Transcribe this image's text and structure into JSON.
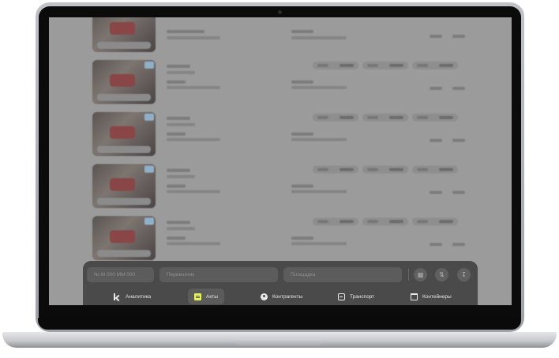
{
  "search": {
    "number_placeholder": "№ М 000 ММ 000",
    "carrier_placeholder": "Перевозчик",
    "area_placeholder": "Площадка"
  },
  "toolbar": {
    "calendar_icon": "calendar-icon",
    "sort_icon": "sort-icon",
    "download_icon": "download-icon"
  },
  "nav": {
    "items": [
      {
        "label": "Аналитика",
        "icon": "chart-icon"
      },
      {
        "label": "Акты",
        "icon": "document-icon",
        "active": true
      },
      {
        "label": "Контрагенты",
        "icon": "person-icon"
      },
      {
        "label": "Транспорт",
        "icon": "bus-icon"
      },
      {
        "label": "Контейнеры",
        "icon": "bin-icon"
      }
    ]
  },
  "colors": {
    "accent": "#e8f35a",
    "toolbar_bg": "#4a4a4a",
    "screen_overlay": "#9b9b9b"
  }
}
